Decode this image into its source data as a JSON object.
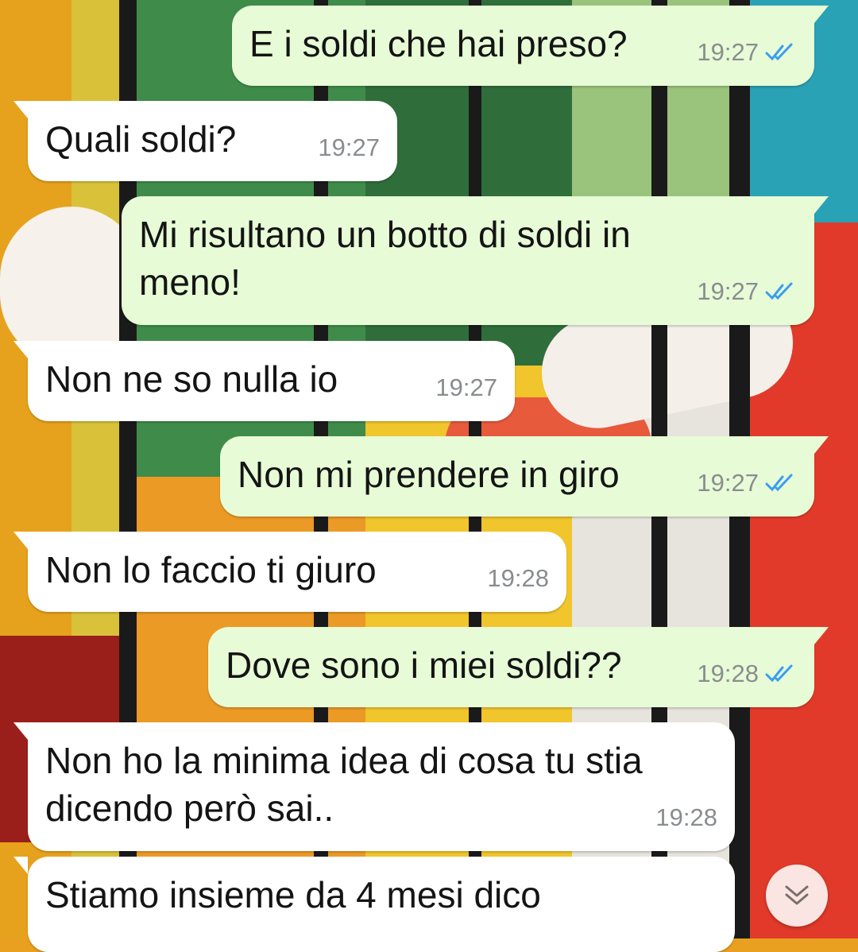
{
  "messages": [
    {
      "direction": "outgoing",
      "text": "E i soldi che hai preso?",
      "time": "19:27",
      "status": "read"
    },
    {
      "direction": "incoming",
      "text": "Quali soldi?",
      "time": "19:27"
    },
    {
      "direction": "outgoing",
      "text": "Mi risultano un botto di soldi in meno!",
      "time": "19:27",
      "status": "read"
    },
    {
      "direction": "incoming",
      "text": "Non ne so nulla io",
      "time": "19:27"
    },
    {
      "direction": "outgoing",
      "text": "Non mi prendere in giro",
      "time": "19:27",
      "status": "read"
    },
    {
      "direction": "incoming",
      "text": "Non lo faccio ti giuro",
      "time": "19:28"
    },
    {
      "direction": "outgoing",
      "text": "Dove sono i miei soldi??",
      "time": "19:28",
      "status": "read"
    },
    {
      "direction": "incoming",
      "text": "Non ho la minima idea di cosa tu stia dicendo però sai..",
      "time": "19:28"
    },
    {
      "direction": "incoming",
      "text": "Stiamo insieme da 4 mesi dico",
      "time": ""
    }
  ],
  "icons": {
    "read_receipt": "double-check-icon",
    "scroll_down": "double-chevron-down-icon"
  },
  "colors": {
    "outgoing_bubble": "#e7fcd6",
    "incoming_bubble": "#ffffff",
    "read_tick": "#3b9df0",
    "timestamp": "#8a8d8f",
    "scroll_button": "#fbe5e2"
  }
}
